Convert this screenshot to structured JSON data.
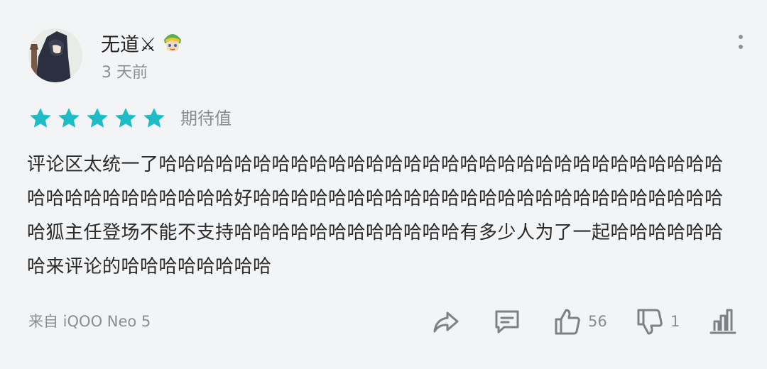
{
  "user": {
    "name": "无道⚔",
    "time": "3 天前"
  },
  "rating": {
    "stars": 5,
    "max": 5,
    "label": "期待值",
    "color": "#1fbcc8"
  },
  "comment": {
    "text": "评论区太统一了哈哈哈哈哈哈哈哈哈哈哈哈哈哈哈哈哈哈哈哈哈哈哈哈哈哈哈哈哈哈哈哈哈哈哈哈哈哈哈哈哈好哈哈哈哈哈哈哈哈哈哈哈哈哈哈哈哈哈哈哈哈哈哈哈哈哈哈狐主任登场不能不支持哈哈哈哈哈哈哈哈哈哈哈哈有多少人为了一起哈哈哈哈哈哈哈来评论的哈哈哈哈哈哈哈哈"
  },
  "footer": {
    "source": "来自 iQOO Neo 5",
    "likes": "56",
    "dislikes": "1"
  },
  "icons": {
    "share": "share-icon",
    "reply": "comment-icon",
    "like": "thumbs-up-icon",
    "dislike": "thumbs-down-icon",
    "stats": "bar-chart-icon",
    "more": "more-vertical-icon"
  }
}
